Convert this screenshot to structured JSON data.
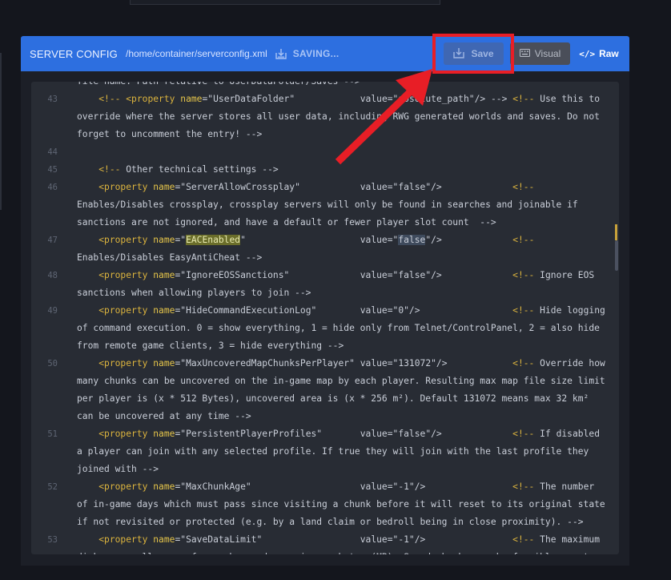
{
  "header": {
    "title": "SERVER CONFIG",
    "path": "/home/container/serverconfig.xml",
    "status": "SAVING...",
    "colors": {
      "bar": "#2d6fe0",
      "highlight": "#e81e26"
    }
  },
  "toolbar": {
    "save_label": "Save",
    "visual_label": "Visual",
    "raw_glyph": "</>",
    "raw_label": "Raw"
  },
  "editor": {
    "lines": [
      {
        "n": "",
        "t": "file name. Path relative to UserDataFolder/Saves -->"
      },
      {
        "n": "43",
        "t": "    <!-- <property name=\"UserDataFolder\"            value=\"absolute_path\"/> --> <!-- Use this to"
      },
      {
        "n": "",
        "t": "override where the server stores all user data, including RWG generated worlds and saves. Do not"
      },
      {
        "n": "",
        "t": "forget to uncomment the entry! -->"
      },
      {
        "n": "44",
        "t": ""
      },
      {
        "n": "45",
        "t": "    <!-- Other technical settings -->"
      },
      {
        "n": "46",
        "t": "    <property name=\"ServerAllowCrossplay\"           value=\"false\"/>             <!--"
      },
      {
        "n": "",
        "t": "Enables/Disables crossplay, crossplay servers will only be found in searches and joinable if"
      },
      {
        "n": "",
        "t": "sanctions are not ignored, and have a default or fewer player slot count  -->"
      },
      {
        "n": "47",
        "t": "    <property name=\"EACEnabled\"                     value=\"false\"/>             <!--"
      },
      {
        "n": "",
        "t": "Enables/Disables EasyAntiCheat -->"
      },
      {
        "n": "48",
        "t": "    <property name=\"IgnoreEOSSanctions\"             value=\"false\"/>             <!-- Ignore EOS"
      },
      {
        "n": "",
        "t": "sanctions when allowing players to join -->"
      },
      {
        "n": "49",
        "t": "    <property name=\"HideCommandExecutionLog\"        value=\"0\"/>                 <!-- Hide logging"
      },
      {
        "n": "",
        "t": "of command execution. 0 = show everything, 1 = hide only from Telnet/ControlPanel, 2 = also hide"
      },
      {
        "n": "",
        "t": "from remote game clients, 3 = hide everything -->"
      },
      {
        "n": "50",
        "t": "    <property name=\"MaxUncoveredMapChunksPerPlayer\" value=\"131072\"/>            <!-- Override how"
      },
      {
        "n": "",
        "t": "many chunks can be uncovered on the in-game map by each player. Resulting max map file size limit"
      },
      {
        "n": "",
        "t": "per player is (x * 512 Bytes), uncovered area is (x * 256 m²). Default 131072 means max 32 km²"
      },
      {
        "n": "",
        "t": "can be uncovered at any time -->"
      },
      {
        "n": "51",
        "t": "    <property name=\"PersistentPlayerProfiles\"       value=\"false\"/>             <!-- If disabled"
      },
      {
        "n": "",
        "t": "a player can join with any selected profile. If true they will join with the last profile they"
      },
      {
        "n": "",
        "t": "joined with -->"
      },
      {
        "n": "52",
        "t": "    <property name=\"MaxChunkAge\"                    value=\"-1\"/>                <!-- The number"
      },
      {
        "n": "",
        "t": "of in-game days which must pass since visiting a chunk before it will reset to its original state"
      },
      {
        "n": "",
        "t": "if not revisited or protected (e.g. by a land claim or bedroll being in close proximity). -->"
      },
      {
        "n": "53",
        "t": "    <property name=\"SaveDataLimit\"                  value=\"-1\"/>                <!-- The maximum"
      },
      {
        "n": "",
        "t": "disk space allowance for each saved game in megabytes (MB). Saved chunks may be forcibly reset"
      }
    ]
  }
}
